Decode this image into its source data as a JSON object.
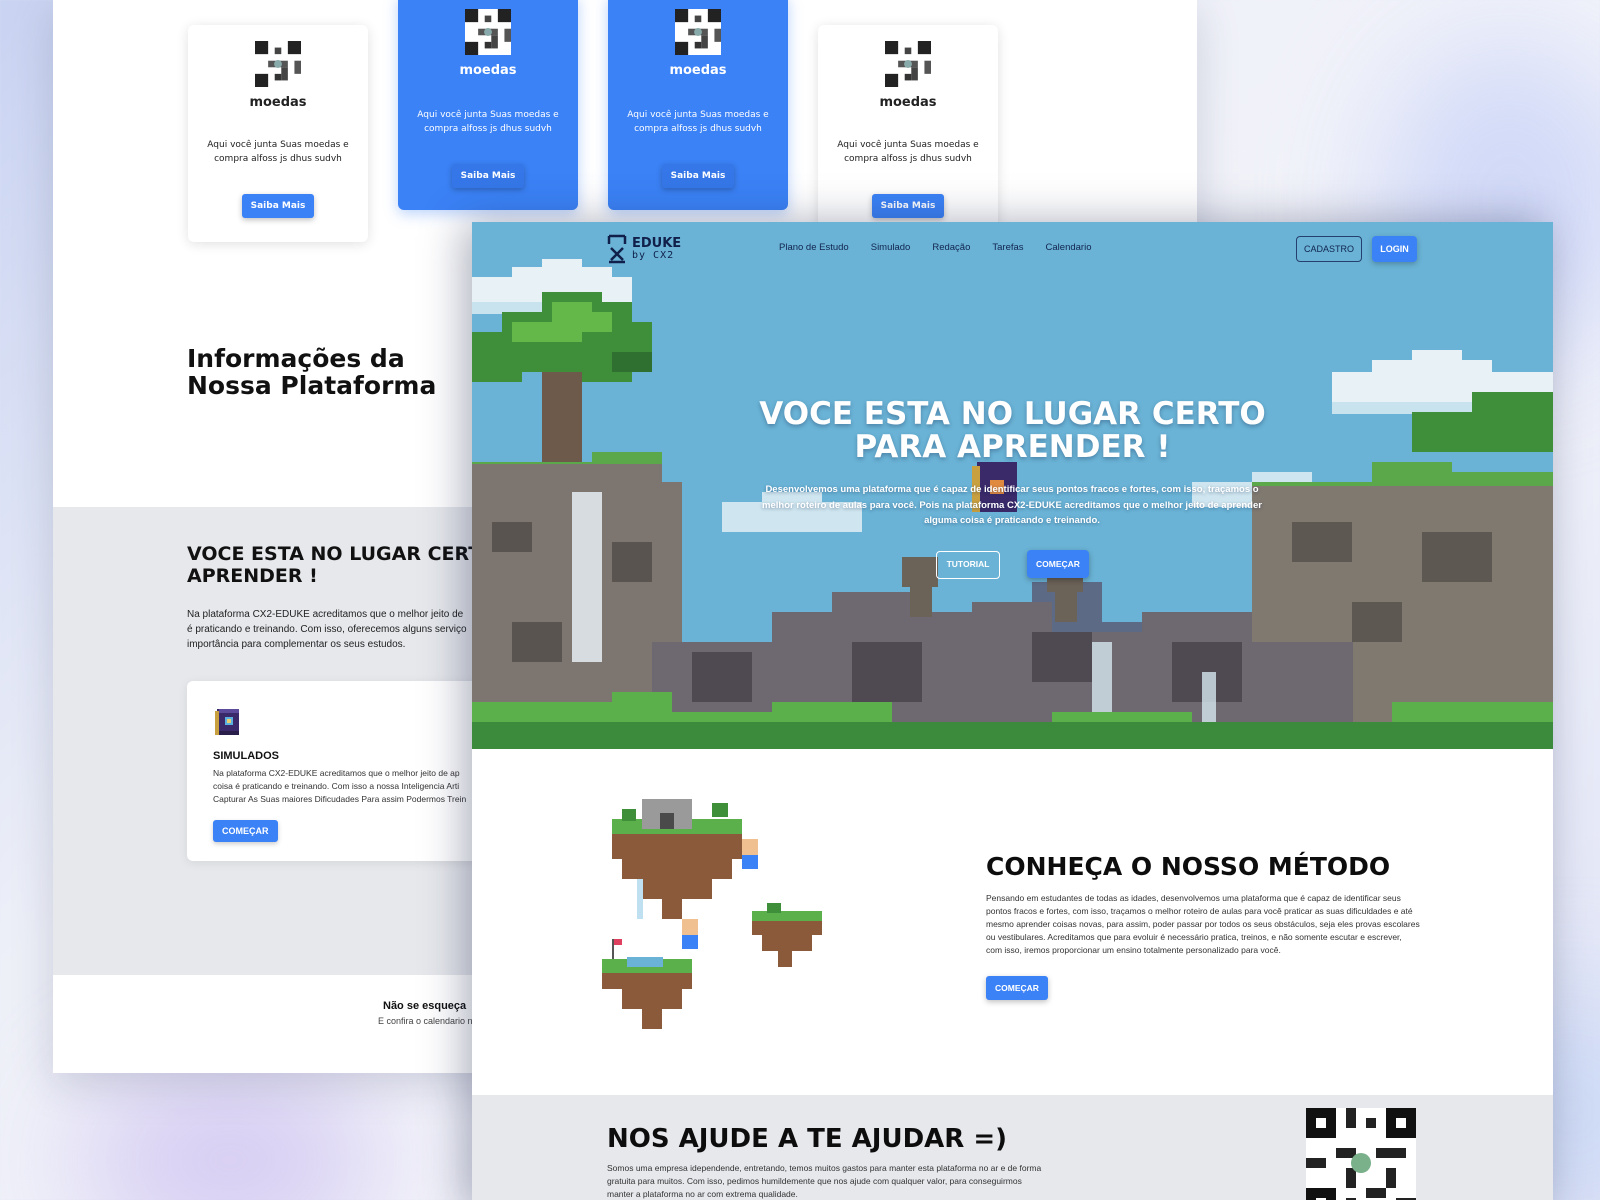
{
  "back_page": {
    "coin_cards": [
      {
        "title": "moedas",
        "description": "Aqui você junta Suas moedas e compra alfoss js dhus sudvh",
        "button": "Saiba Mais",
        "variant": "white"
      },
      {
        "title": "moedas",
        "description": "Aqui você junta Suas moedas e compra alfoss js dhus sudvh",
        "button": "Saiba Mais",
        "variant": "blue"
      },
      {
        "title": "moedas",
        "description": "Aqui você junta Suas moedas e compra alfoss js dhus sudvh",
        "button": "Saiba Mais",
        "variant": "blue"
      },
      {
        "title": "moedas",
        "description": "Aqui você junta Suas moedas e compra alfoss js dhus sudvh",
        "button": "Saiba Mais",
        "variant": "white"
      }
    ],
    "info_title_line1": "Informações da",
    "info_title_line2": "Nossa Plataforma",
    "hero_title_line1": "VOCE ESTA NO LUGAR CERTO",
    "hero_title_line2": "APRENDER !",
    "hero_text_lines": [
      "Na plataforma CX2-EDUKE acreditamos que o melhor jeito de",
      "é praticando e treinando. Com isso, oferecemos alguns serviço",
      "importância para complementar os seus estudos."
    ],
    "simulados_card": {
      "name": "SIMULADOS",
      "text_lines": [
        "Na plataforma CX2-EDUKE acreditamos que o melhor jeito de ap",
        "coisa é praticando e treinando. Com isso a nossa Inteligencia Arti",
        "Capturar As Suas maiores Dificudades Para assim Podermos Trein"
      ],
      "button": "COMEÇAR",
      "icon": "book-icon"
    },
    "footer_title": "Não se esqueça",
    "footer_sub": "E confira o calendario n"
  },
  "front_page": {
    "nav": {
      "logo_line1": "EDUKE",
      "logo_line2": "by CX2",
      "links": [
        "Plano de Estudo",
        "Simulado",
        "Redação",
        "Tarefas",
        "Calendario"
      ],
      "cadastro": "CADASTRO",
      "login": "LOGIN"
    },
    "hero": {
      "title_line1": "VOCE ESTA NO LUGAR CERTO",
      "title_line2": "PARA APRENDER !",
      "text": "Desenvolvemos uma plataforma que é capaz de identificar seus pontos fracos e fortes, com isso, traçamos o melhor roteiro de aulas para você. Pois na plataforma CX2-EDUKE acreditamos que o melhor jeito de aprender alguma coisa é praticando e treinando.",
      "tutorial_button": "TUTORIAL",
      "start_button": "COMEÇAR"
    },
    "metodo": {
      "title": "CONHEÇA O NOSSO MÉTODO",
      "text": "Pensando em estudantes de todas as idades, desenvolvemos uma plataforma que é capaz de identificar seus pontos fracos e fortes, com isso, traçamos o melhor roteiro de aulas para você praticar as suas dificuldades e até mesmo aprender coisas novas, para assim, poder passar por todos os seus obstáculos, seja eles provas escolares ou vestibulares. Acreditamos que para evoluir é necessário pratica, treinos, e não somente escutar e escrever, com isso, iremos proporcionar um ensino totalmente personalizado para você.",
      "button": "COMEÇAR"
    },
    "help": {
      "title": "NOS AJUDE A TE AJUDAR =)",
      "text": "Somos uma empresa idependende, entretando, temos muitos gastos para manter esta plataforma no ar e de forma gratuita para muitos. Com isso, pedimos humildemente que nos ajude com qualquer valor, para conseguirmos manter a plataforma no ar com extrema qualidade."
    }
  },
  "colors": {
    "accent": "#3b82f6",
    "sky": "#6ab3d6",
    "gray_section": "#e6e8ec",
    "navy_text": "#12244e"
  }
}
